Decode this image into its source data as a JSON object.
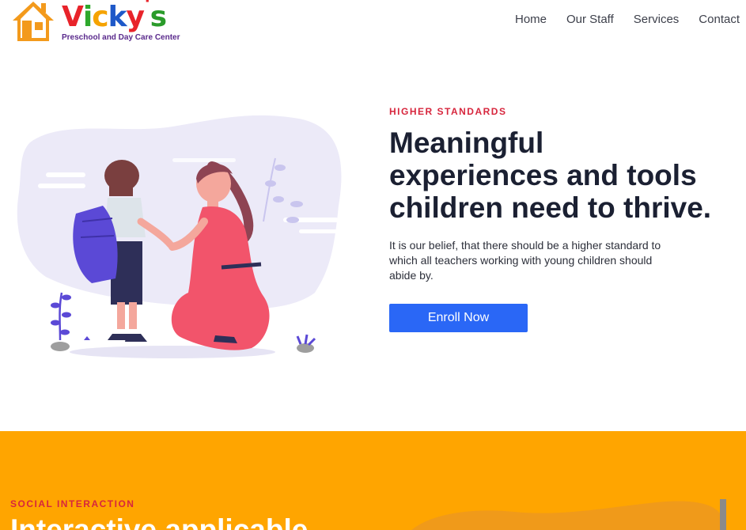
{
  "header": {
    "logo_text": "Vicky's",
    "logo_letters": [
      "V",
      "i",
      "c",
      "k",
      "y",
      "'",
      "s"
    ],
    "logo_colors": [
      "#e8232a",
      "#2ea82c",
      "#f5a300",
      "#1e58c8",
      "#e8232a",
      "#e8232a",
      "#2a9b2a"
    ],
    "logo_subtitle": "Preschool and Day Care Center",
    "nav": [
      {
        "label": "Home"
      },
      {
        "label": "Our Staff"
      },
      {
        "label": "Services"
      },
      {
        "label": "Contact"
      }
    ]
  },
  "hero": {
    "kicker": "HIGHER STANDARDS",
    "headline_lines": [
      "Meaningful",
      "experiences and tools",
      "children need to thrive."
    ],
    "description": "It is our belief, that there should be a higher standard to which all teachers working with young children should abide by.",
    "button_label": "Enroll Now",
    "accent_color": "#d7263d",
    "button_color": "#2a67f6"
  },
  "section2": {
    "kicker": "SOCIAL INTERACTION",
    "headline": "Interactive applicable",
    "background_color": "#ffa500"
  },
  "icons": [
    "house-logo-icon"
  ]
}
